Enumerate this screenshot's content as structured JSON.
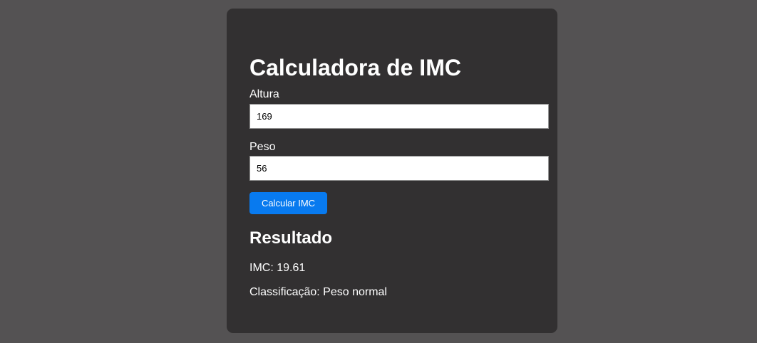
{
  "calculator": {
    "title": "Calculadora de IMC",
    "height_label": "Altura",
    "height_value": "169",
    "weight_label": "Peso",
    "weight_value": "56",
    "button_label": "Calcular IMC"
  },
  "result": {
    "heading": "Resultado",
    "imc_text": "IMC: 19.61",
    "classification_text": "Classificação: Peso normal"
  },
  "colors": {
    "page_background": "#545253",
    "card_background": "#323031",
    "button_background": "#087aef",
    "text": "#ffffff"
  }
}
